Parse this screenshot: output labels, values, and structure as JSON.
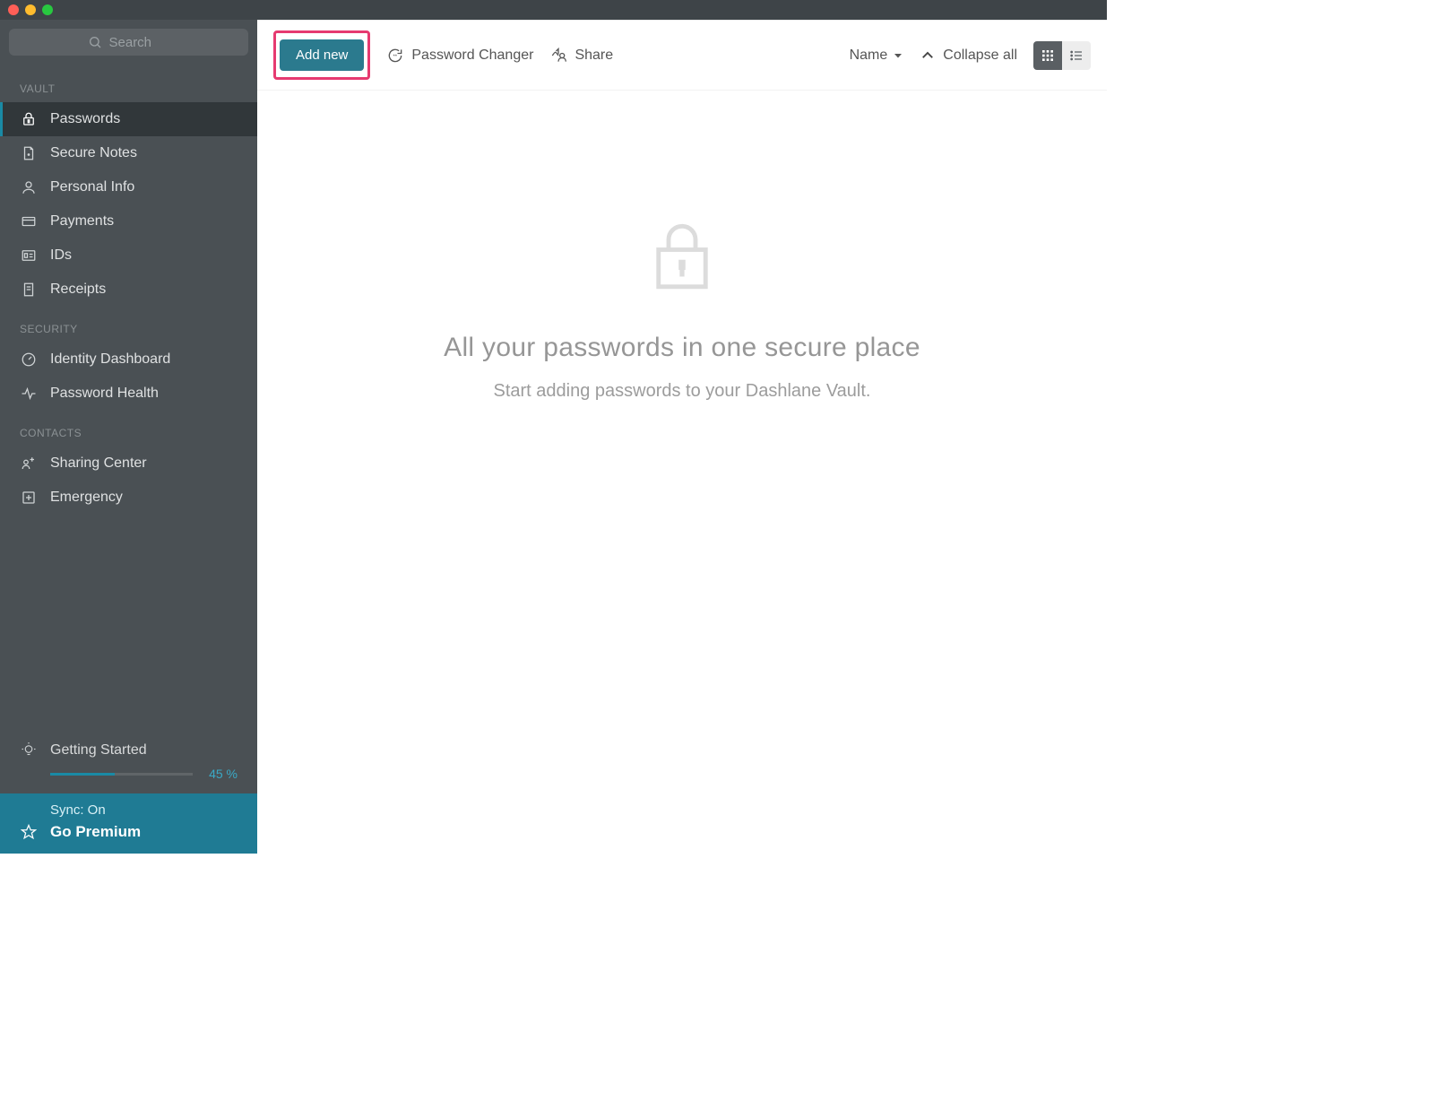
{
  "search": {
    "placeholder": "Search"
  },
  "sidebar": {
    "sections": {
      "vault": {
        "head": "VAULT",
        "items": [
          {
            "label": "Passwords"
          },
          {
            "label": "Secure Notes"
          },
          {
            "label": "Personal Info"
          },
          {
            "label": "Payments"
          },
          {
            "label": "IDs"
          },
          {
            "label": "Receipts"
          }
        ]
      },
      "security": {
        "head": "SECURITY",
        "items": [
          {
            "label": "Identity Dashboard"
          },
          {
            "label": "Password Health"
          }
        ]
      },
      "contacts": {
        "head": "CONTACTS",
        "items": [
          {
            "label": "Sharing Center"
          },
          {
            "label": "Emergency"
          }
        ]
      }
    },
    "getting_started": {
      "label": "Getting Started",
      "progress_pct": 45,
      "progress_text": "45 %"
    },
    "footer": {
      "sync_label": "Sync: On",
      "premium_label": "Go Premium"
    }
  },
  "toolbar": {
    "add_new": "Add new",
    "password_changer": "Password Changer",
    "share": "Share",
    "sort_label": "Name",
    "collapse_label": "Collapse all"
  },
  "empty_state": {
    "heading": "All your passwords in one secure place",
    "subheading": "Start adding passwords to your Dashlane Vault."
  },
  "colors": {
    "accent": "#1f7b94",
    "highlight": "#e63a70",
    "sidebar_bg": "#4a5054"
  }
}
